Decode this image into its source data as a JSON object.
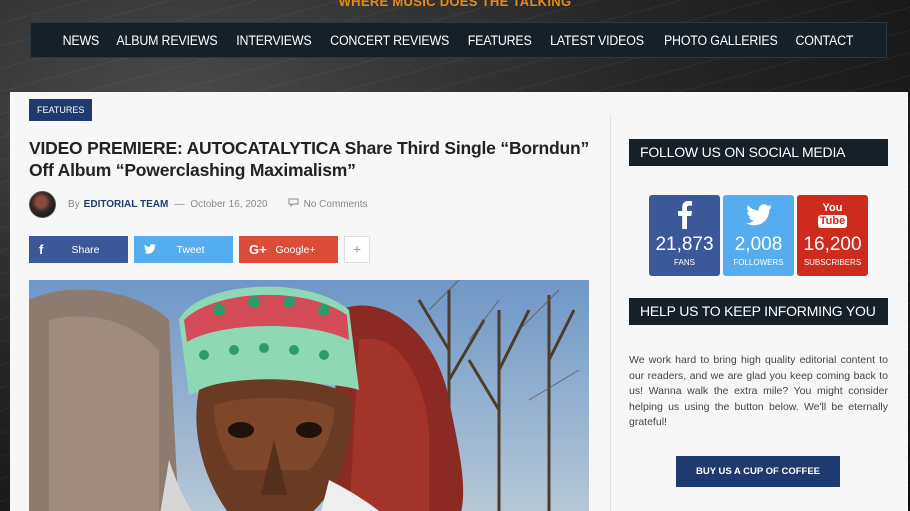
{
  "header": {
    "tagline": "WHERE MUSIC DOES THE TALKING"
  },
  "nav": {
    "items": [
      "NEWS",
      "ALBUM REVIEWS",
      "INTERVIEWS",
      "CONCERT REVIEWS",
      "FEATURES",
      "LATEST VIDEOS",
      "PHOTO GALLERIES",
      "CONTACT"
    ]
  },
  "article": {
    "category": "FEATURES",
    "title": "VIDEO PREMIERE: AUTOCATALYTICA Share Third Single “Borndun” Off Album “Powerclashing Maximalism”",
    "by_label": "By",
    "author": "EDITORIAL TEAM",
    "separator": "—",
    "date": "October 16, 2020",
    "comments": "No Comments"
  },
  "share": {
    "facebook": {
      "icon": "f",
      "label": "Share",
      "color": "#3b5998"
    },
    "twitter": {
      "icon": "❧",
      "label": "Tweet",
      "color": "#55acee"
    },
    "googleplus": {
      "icon": "G+",
      "label": "Google+",
      "color": "#dd4b39"
    },
    "more": "+"
  },
  "sidebar": {
    "social_title": "FOLLOW US ON SOCIAL MEDIA",
    "social": [
      {
        "network": "facebook",
        "icon": "facebook-icon",
        "count": "21,873",
        "unit": "FANS",
        "color": "#3b5998"
      },
      {
        "network": "twitter",
        "icon": "twitter-icon",
        "count": "2,008",
        "unit": "FOLLOWERS",
        "color": "#55acee"
      },
      {
        "network": "youtube",
        "icon": "youtube-icon",
        "count": "16,200",
        "unit": "SUBSCRIBERS",
        "color": "#cc2b1e"
      }
    ],
    "help_title": "HELP US TO KEEP INFORMING YOU",
    "help_text": "We work hard to bring high quality editorial content to our readers, and we are glad you keep coming back to us! Wanna walk the extra mile? You might consider helping us using the button below. We'll be eternally grateful!",
    "coffee_button": "BUY US A CUP OF COFFEE",
    "youtube_logo_top": "You",
    "youtube_logo_bottom": "Tube"
  },
  "colors": {
    "accent": "#1e3a6e",
    "nav_bg": "#162029",
    "tagline": "#e88a1a"
  }
}
